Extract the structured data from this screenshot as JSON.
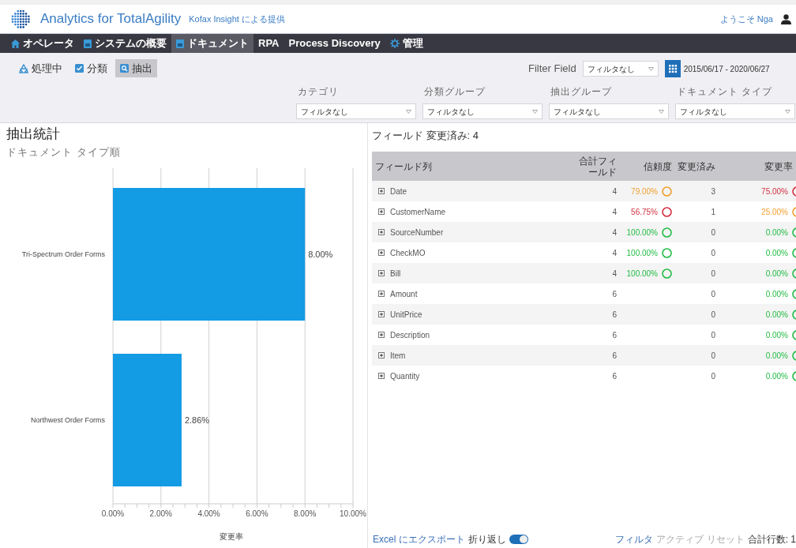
{
  "header": {
    "product": "Analytics for TotalAgility",
    "powered_by": "Kofax Insight による提供",
    "welcome": "ようこそ Nga"
  },
  "nav": [
    {
      "label": "オペレータ",
      "selected": false
    },
    {
      "label": "システムの概要",
      "selected": false
    },
    {
      "label": "ドキュメント",
      "selected": true
    },
    {
      "label": "RPA",
      "selected": false
    },
    {
      "label": "Process Discovery",
      "selected": false
    },
    {
      "label": "管理",
      "selected": false
    }
  ],
  "subtabs": [
    {
      "label": "処理中",
      "selected": false
    },
    {
      "label": "分類",
      "selected": false
    },
    {
      "label": "抽出",
      "selected": true
    }
  ],
  "filter_field": {
    "label": "Filter Field",
    "value": "フィルタなし",
    "date_range": "2015/06/17 - 2020/06/27"
  },
  "filters": [
    {
      "label": "カテゴリ",
      "value": "フィルタなし"
    },
    {
      "label": "分類グループ",
      "value": "フィルタなし"
    },
    {
      "label": "抽出グループ",
      "value": "フィルタなし"
    },
    {
      "label": "ドキュメント タイプ",
      "value": "フィルタなし"
    }
  ],
  "left": {
    "title": "抽出統計",
    "subtitle": "ドキュメント タイプ順",
    "chart_data": {
      "type": "bar",
      "orientation": "horizontal",
      "grid": true,
      "xlabel": "変更率",
      "categories": [
        "Tri-Spectrum Order Forms",
        "Northwest Order Forms"
      ],
      "values": [
        8.0,
        2.86
      ],
      "xlim": [
        0,
        10
      ],
      "xticks": [
        {
          "value": 0,
          "label": "0.00%"
        },
        {
          "value": 2,
          "label": "2.00%"
        },
        {
          "value": 4,
          "label": "4.00%"
        },
        {
          "value": 6,
          "label": "6.00%"
        },
        {
          "value": 8,
          "label": "8.00%"
        },
        {
          "value": 10,
          "label": "10.00%"
        }
      ],
      "value_labels": [
        "8.00%",
        "2.86%"
      ]
    }
  },
  "right": {
    "title": "フィールド 変更済み: 4",
    "columns": [
      "フィールド列",
      "合計フィールド",
      "信頼度",
      "変更済み",
      "変更率"
    ],
    "rows": [
      {
        "name": "Date",
        "total": "4",
        "confidence": {
          "text": "79.00%",
          "color": "#f0a030"
        },
        "changed": "3",
        "rate": {
          "text": "75.00%",
          "color": "#d03040"
        }
      },
      {
        "name": "CustomerName",
        "total": "4",
        "confidence": {
          "text": "56.75%",
          "color": "#d03040"
        },
        "changed": "1",
        "rate": {
          "text": "25.00%",
          "color": "#f0a030"
        }
      },
      {
        "name": "SourceNumber",
        "total": "4",
        "confidence": {
          "text": "100.00%",
          "color": "#22bb44"
        },
        "changed": "0",
        "rate": {
          "text": "0.00%",
          "color": "#22bb44"
        }
      },
      {
        "name": "CheckMO",
        "total": "4",
        "confidence": {
          "text": "100.00%",
          "color": "#22bb44"
        },
        "changed": "0",
        "rate": {
          "text": "0.00%",
          "color": "#22bb44"
        }
      },
      {
        "name": "Bill",
        "total": "4",
        "confidence": {
          "text": "100.00%",
          "color": "#22bb44"
        },
        "changed": "0",
        "rate": {
          "text": "0.00%",
          "color": "#22bb44"
        }
      },
      {
        "name": "Amount",
        "total": "6",
        "changed": "0",
        "rate": {
          "text": "0.00%",
          "color": "#22bb44"
        }
      },
      {
        "name": "UnitPrice",
        "total": "6",
        "changed": "0",
        "rate": {
          "text": "0.00%",
          "color": "#22bb44"
        }
      },
      {
        "name": "Description",
        "total": "6",
        "changed": "0",
        "rate": {
          "text": "0.00%",
          "color": "#22bb44"
        }
      },
      {
        "name": "Item",
        "total": "6",
        "changed": "0",
        "rate": {
          "text": "0.00%",
          "color": "#22bb44"
        }
      },
      {
        "name": "Quantity",
        "total": "6",
        "changed": "0",
        "rate": {
          "text": "0.00%",
          "color": "#22bb44"
        }
      }
    ],
    "footer": {
      "export": "Excel にエクスポート",
      "wrap_label": "折り返し",
      "wrap_on": true,
      "filter": "フィルタ",
      "active": "アクティブ",
      "reset": "リセット",
      "total_rows": "合計行数: 1"
    }
  }
}
